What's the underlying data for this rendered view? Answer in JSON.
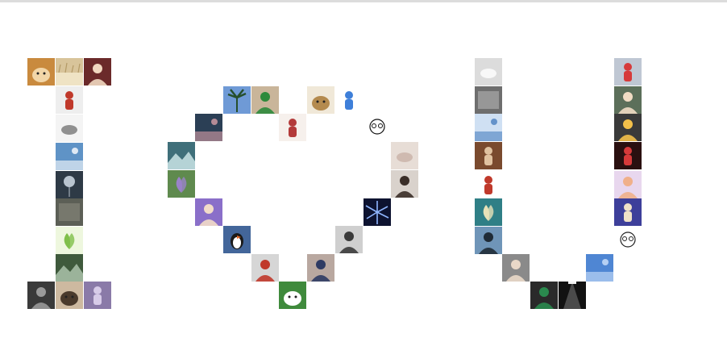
{
  "page": {
    "background": "#ffffff",
    "topbar_color": "#dcdcdc"
  },
  "photo_wall": {
    "letter_i": [
      {
        "id": "i-top-1",
        "icon": "shiba-dog-photo",
        "bg": "#c98a3e",
        "fg": "#f2d6a8",
        "motif": "dog"
      },
      {
        "id": "i-top-2",
        "icon": "wheat-field-photo",
        "bg": "#d8c49a",
        "fg": "#efe3c4",
        "motif": "field"
      },
      {
        "id": "i-top-3",
        "icon": "cartoon-girl-avatar",
        "bg": "#6b2a2a",
        "fg": "#f1d8c0",
        "motif": "person"
      },
      {
        "id": "i-2",
        "icon": "red-character-avatar",
        "bg": "#eeeeee",
        "fg": "#c0392b",
        "motif": "figure"
      },
      {
        "id": "i-3",
        "icon": "grey-shoe-photo",
        "bg": "#f4f4f4",
        "fg": "#777777",
        "motif": "object"
      },
      {
        "id": "i-4",
        "icon": "sky-building-photo",
        "bg": "#5f93c6",
        "fg": "#ffffff",
        "motif": "sky"
      },
      {
        "id": "i-5",
        "icon": "balloon-night-photo",
        "bg": "#2e3a46",
        "fg": "#b9c4cf",
        "motif": "balloon"
      },
      {
        "id": "i-6",
        "icon": "grey-street-photo",
        "bg": "#5c5f56",
        "fg": "#a9a998",
        "motif": "dark"
      },
      {
        "id": "i-7",
        "icon": "clover-leaf-photo",
        "bg": "#eef7de",
        "fg": "#7fbf4a",
        "motif": "leaf"
      },
      {
        "id": "i-8",
        "icon": "forest-road-photo",
        "bg": "#3f5a3c",
        "fg": "#9bb39a",
        "motif": "landscape"
      },
      {
        "id": "i-9",
        "icon": "man-silhouette-photo",
        "bg": "#3a3a3a",
        "fg": "#9a9a9a",
        "motif": "person"
      },
      {
        "id": "i-bot-1",
        "icon": "red-fireworks-photo",
        "bg": "#1a1010",
        "fg": "#e23b3b",
        "motif": "burst"
      },
      {
        "id": "i-bot-2",
        "icon": "purple-figure-photo",
        "bg": "#8a7aa8",
        "fg": "#d7cbe8",
        "motif": "figure"
      },
      {
        "id": "i-bot-3",
        "icon": "cat-sleeping-photo",
        "bg": "#cdb9a0",
        "fg": "#4a3a2c",
        "motif": "dog"
      }
    ],
    "heart": [
      {
        "id": "h-1",
        "icon": "palm-tree-sky-photo",
        "bg": "#6f9ad6",
        "fg": "#264f2c",
        "motif": "tree"
      },
      {
        "id": "h-2",
        "icon": "smiling-boy-photo",
        "bg": "#c9b59a",
        "fg": "#2e8a3c",
        "motif": "person"
      },
      {
        "id": "h-3",
        "icon": "camel-cartoon-photo",
        "bg": "#f0e8d8",
        "fg": "#b48a4e",
        "motif": "dog"
      },
      {
        "id": "h-4",
        "icon": "stitch-cartoon-avatar",
        "bg": "#ffffff",
        "fg": "#3e7fd9",
        "motif": "figure"
      },
      {
        "id": "h-5",
        "icon": "ocean-sunset-photo",
        "bg": "#2b3f55",
        "fg": "#d89fa6",
        "motif": "sky"
      },
      {
        "id": "h-6",
        "icon": "boxing-kids-photo",
        "bg": "#f6f0ec",
        "fg": "#b33a3a",
        "motif": "figure"
      },
      {
        "id": "h-7",
        "icon": "glasses-sketch-avatar",
        "bg": "#ffffff",
        "fg": "#111111",
        "motif": "sketch"
      },
      {
        "id": "h-8",
        "icon": "mountain-lake-photo",
        "bg": "#3f6f7a",
        "fg": "#b5d3d6",
        "motif": "landscape"
      },
      {
        "id": "h-9",
        "icon": "baby-hand-photo",
        "bg": "#e7ddd6",
        "fg": "#c9b2a6",
        "motif": "object"
      },
      {
        "id": "h-10",
        "icon": "lavender-field-photo",
        "bg": "#5f8a4e",
        "fg": "#9a82c9",
        "motif": "leaf"
      },
      {
        "id": "h-11",
        "icon": "young-man-portrait-photo",
        "bg": "#d9d2cc",
        "fg": "#3a2e28",
        "motif": "person"
      },
      {
        "id": "h-12",
        "icon": "anime-boy-avatar",
        "bg": "#8a6fc9",
        "fg": "#f2dcc8",
        "motif": "person"
      },
      {
        "id": "h-13",
        "icon": "galaxy-photo",
        "bg": "#0d1330",
        "fg": "#8fb6ff",
        "motif": "burst"
      },
      {
        "id": "h-14",
        "icon": "puffin-bird-photo",
        "bg": "#43669a",
        "fg": "#ffffff",
        "motif": "bird"
      },
      {
        "id": "h-15",
        "icon": "woman-bw-portrait-photo",
        "bg": "#cfcfcf",
        "fg": "#3a3a3a",
        "motif": "person"
      },
      {
        "id": "h-16",
        "icon": "man-red-shirt-photo",
        "bg": "#d6d6d6",
        "fg": "#c0392b",
        "motif": "person"
      },
      {
        "id": "h-17",
        "icon": "glasses-boy-photo",
        "bg": "#b9a8a0",
        "fg": "#2f3b63",
        "motif": "person"
      },
      {
        "id": "h-18",
        "icon": "husky-santa-hat-photo",
        "bg": "#3f8a3c",
        "fg": "#ffffff",
        "motif": "dog"
      }
    ],
    "letter_u": [
      {
        "id": "u-l-1",
        "icon": "white-feather-photo",
        "bg": "#dcdcdc",
        "fg": "#ffffff",
        "motif": "object"
      },
      {
        "id": "u-l-2",
        "icon": "dark-text-poster-photo",
        "bg": "#6e6e6e",
        "fg": "#e6e6e6",
        "motif": "dark"
      },
      {
        "id": "u-l-3",
        "icon": "blue-sky-window-photo",
        "bg": "#cfe0f3",
        "fg": "#4a7fbf",
        "motif": "sky"
      },
      {
        "id": "u-l-4",
        "icon": "brown-room-photo",
        "bg": "#7a4a2e",
        "fg": "#e0c2a0",
        "motif": "figure"
      },
      {
        "id": "u-l-5",
        "icon": "red-rose-girl-photo",
        "bg": "#ffffff",
        "fg": "#c0392b",
        "motif": "figure"
      },
      {
        "id": "u-l-6",
        "icon": "van-gogh-blossom-photo",
        "bg": "#2f7f86",
        "fg": "#e8e2b8",
        "motif": "leaf"
      },
      {
        "id": "u-l-7",
        "icon": "shadow-person-photo",
        "bg": "#6f95b8",
        "fg": "#1f2b36",
        "motif": "person"
      },
      {
        "id": "u-b-1",
        "icon": "bald-man-photo",
        "bg": "#8a8a8a",
        "fg": "#e9d8c8",
        "motif": "person"
      },
      {
        "id": "u-b-2",
        "icon": "athlete-green-jersey-photo",
        "bg": "#2a2a2a",
        "fg": "#2a8a4e",
        "motif": "person"
      },
      {
        "id": "u-b-3",
        "icon": "stage-spotlight-photo",
        "bg": "#121212",
        "fg": "#f2f2f2",
        "motif": "spot"
      },
      {
        "id": "u-r-1",
        "icon": "blue-sky-photo",
        "bg": "#4f86d3",
        "fg": "#cfe2fb",
        "motif": "sky"
      },
      {
        "id": "u-r-2",
        "icon": "girl-long-hair-sketch-avatar",
        "bg": "#ffffff",
        "fg": "#222222",
        "motif": "sketch"
      },
      {
        "id": "u-r-3",
        "icon": "anime-purple-character-avatar",
        "bg": "#3d3f9a",
        "fg": "#f0e2c8",
        "motif": "figure"
      },
      {
        "id": "u-r-4",
        "icon": "cartoon-girl-flowers-avatar",
        "bg": "#e8d7ee",
        "fg": "#f0b08a",
        "motif": "person"
      },
      {
        "id": "u-r-5",
        "icon": "red-hat-anime-avatar",
        "bg": "#2a1010",
        "fg": "#d63a3a",
        "motif": "figure"
      },
      {
        "id": "u-r-6",
        "icon": "naruto-anime-avatar",
        "bg": "#3a3a3a",
        "fg": "#f3c04a",
        "motif": "person"
      },
      {
        "id": "u-r-7",
        "icon": "blond-boy-photo",
        "bg": "#5c6f5a",
        "fg": "#f1dcc4",
        "motif": "person"
      },
      {
        "id": "u-r-8",
        "icon": "ultraman-toy-photo",
        "bg": "#bfc7d3",
        "fg": "#d63a3a",
        "motif": "figure"
      }
    ]
  }
}
